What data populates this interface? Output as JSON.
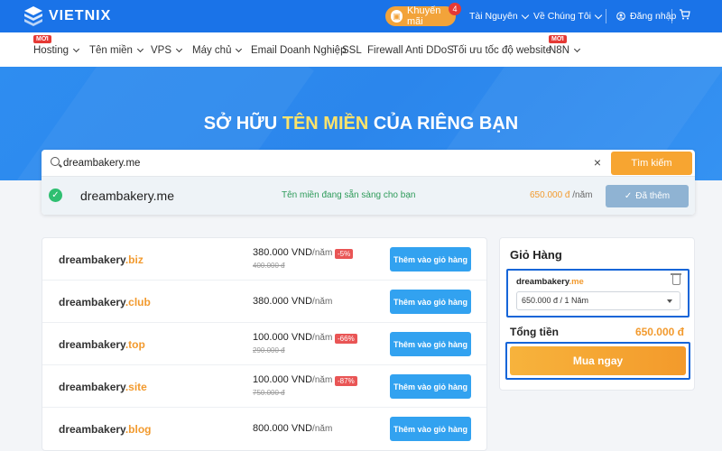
{
  "header": {
    "logo_text": "VIETNIX",
    "promo_label": "Khuyến mãi",
    "promo_count": "4",
    "links": [
      "Tài Nguyên",
      "Về Chúng Tôi"
    ],
    "login_label": "Đăng nhập"
  },
  "nav": {
    "new_tag": "MỚI",
    "items": [
      "Hosting",
      "Tên miền",
      "VPS",
      "Máy chủ",
      "Email Doanh Nghiệp",
      "SSL",
      "Firewall Anti DDoS",
      "Tối ưu tốc độ website",
      "N8N"
    ]
  },
  "hero": {
    "title_part1": "SỞ HỮU ",
    "title_highlight": "TÊN MIỀN",
    "title_part2": " CỦA RIÊNG BẠN"
  },
  "search": {
    "value": "dreambakery.me",
    "button_label": "Tìm kiếm",
    "result_domain": "dreambakery.me",
    "result_status": "Tên miền đang sẵn sàng cho bạn",
    "result_price": "650.000 đ",
    "result_unit": " /năm",
    "added_label": "Đã thêm"
  },
  "domains": [
    {
      "name": "dreambakery",
      "tld": ".biz",
      "price": "380.000 VND",
      "unit": "/năm",
      "old": "400.000 đ",
      "discount": "-5%"
    },
    {
      "name": "dreambakery",
      "tld": ".club",
      "price": "380.000 VND",
      "unit": "/năm",
      "old": "",
      "discount": ""
    },
    {
      "name": "dreambakery",
      "tld": ".top",
      "price": "100.000 VND",
      "unit": "/năm",
      "old": "290.000 đ",
      "discount": "-66%"
    },
    {
      "name": "dreambakery",
      "tld": ".site",
      "price": "100.000 VND",
      "unit": "/năm",
      "old": "750.000 đ",
      "discount": "-87%"
    },
    {
      "name": "dreambakery",
      "tld": ".blog",
      "price": "800.000 VND",
      "unit": "/năm",
      "old": "",
      "discount": ""
    }
  ],
  "add_to_cart_label": "Thêm vào giỏ hàng",
  "cart": {
    "title": "Giỏ Hàng",
    "item_name": "dreambakery",
    "item_tld": ".me",
    "item_option": "650.000 đ / 1 Năm",
    "total_label": "Tổng tiền",
    "total_value": "650.000 đ",
    "buy_label": "Mua ngay"
  },
  "colors": {
    "brand_blue": "#1a73e8",
    "accent_orange": "#f7a531",
    "highlight_yellow": "#fde36b",
    "success_green": "#2fbf71"
  }
}
